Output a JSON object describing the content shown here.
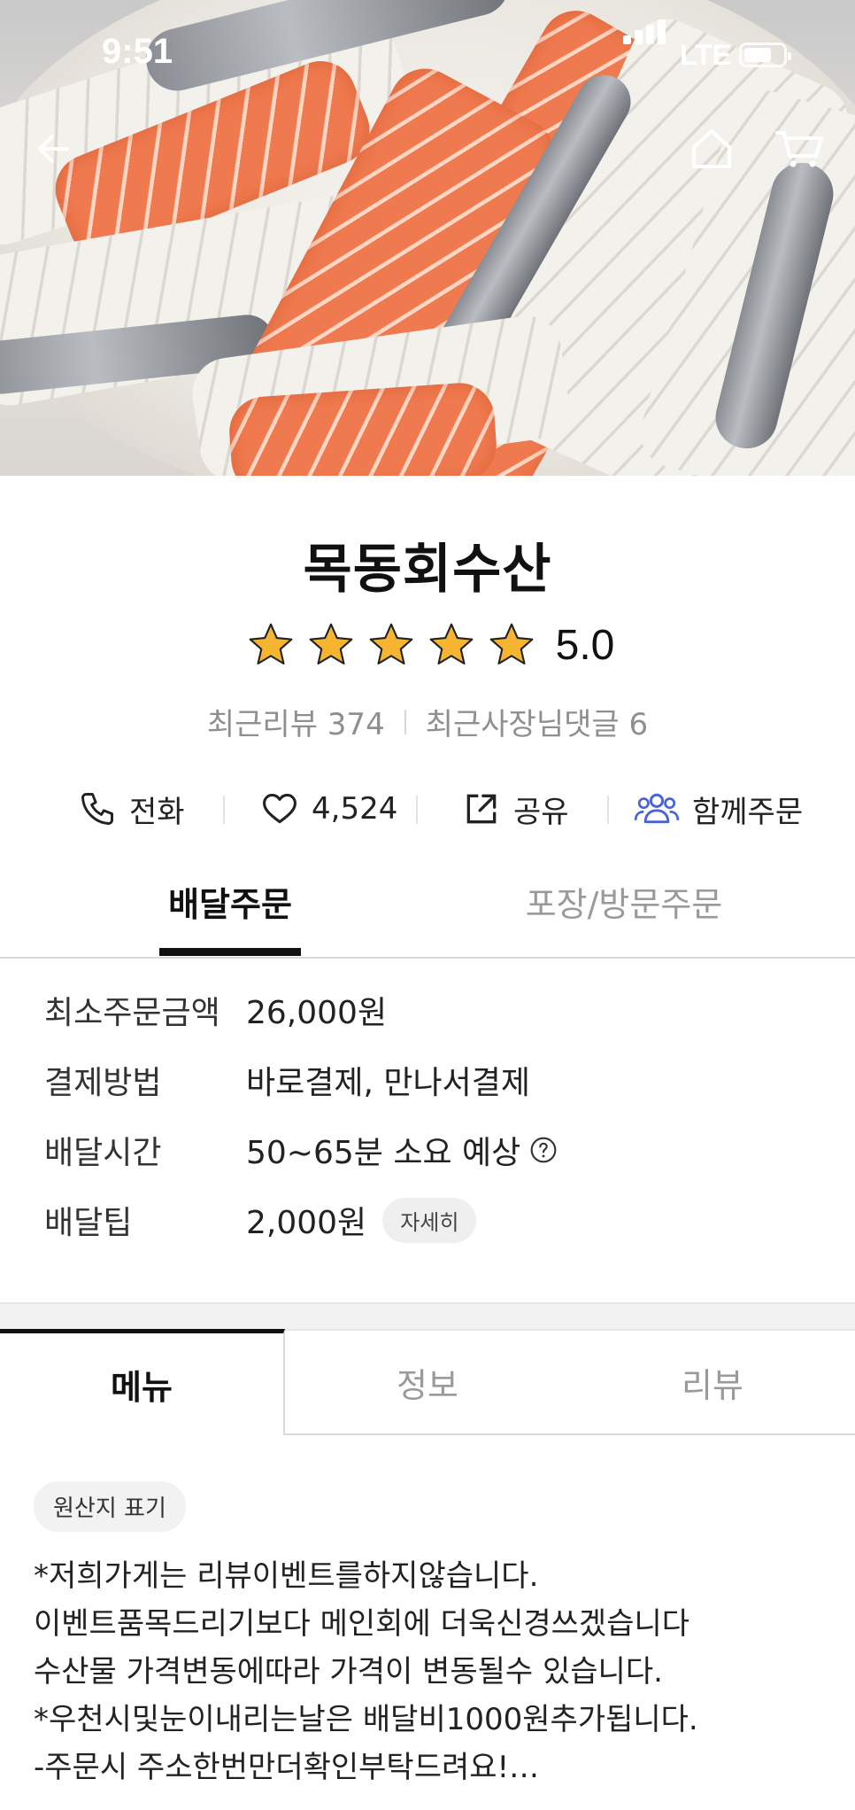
{
  "status_bar": {
    "time": "9:51",
    "network": "LTE"
  },
  "store": {
    "name": "목동회수산",
    "rating": "5.0",
    "star_count": 5,
    "recent_reviews": "최근리뷰 374",
    "recent_owner_replies": "최근사장님댓글 6"
  },
  "actions": {
    "call": "전화",
    "likes": "4,524",
    "share": "공유",
    "group_order": "함께주문"
  },
  "order_tabs": {
    "delivery": "배달주문",
    "pickup": "포장/방문주문",
    "active": "delivery"
  },
  "info": [
    {
      "label": "최소주문금액",
      "value": "26,000원"
    },
    {
      "label": "결제방법",
      "value": "바로결제, 만나서결제"
    },
    {
      "label": "배달시간",
      "value": "50~65분 소요 예상"
    },
    {
      "label": "배달팁",
      "value": "2,000원",
      "chip": "자세히"
    }
  ],
  "menu_tabs": {
    "menu": "메뉴",
    "info": "정보",
    "review": "리뷰",
    "active": "menu"
  },
  "origin_chip": "원산지 표기",
  "notice_lines": [
    "*저희가게는 리뷰이벤트를하지않습니다.",
    "이벤트품목드리기보다 메인회에 더욱신경쓰겠습니다",
    "수산물 가격변동에따라 가격이 변동될수 있습니다.",
    "*우천시및눈이내리는날은 배달비1000원추가됩니다.",
    "-주문시 주소한번만더확인부탁드려요!…"
  ],
  "colors": {
    "star": "#f6b531",
    "group_icon": "#4a64d8",
    "active_tab": "#111111",
    "inactive_tab": "#9a9a9a"
  }
}
